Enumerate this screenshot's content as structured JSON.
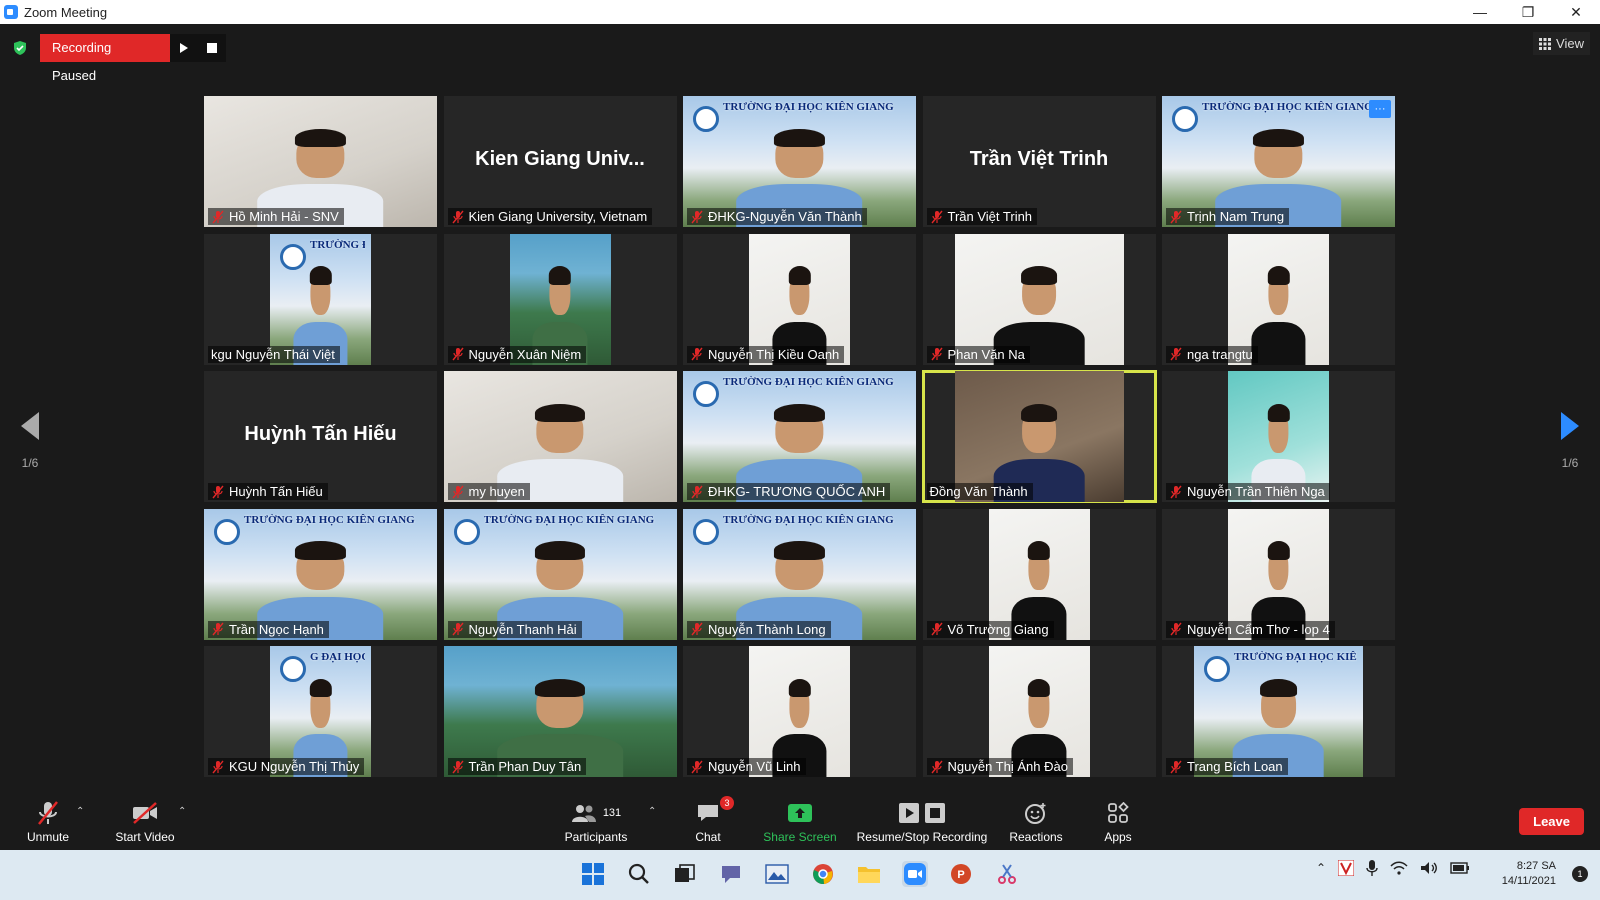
{
  "window": {
    "title": "Zoom Meeting",
    "controls": [
      "minimize",
      "restore",
      "close"
    ]
  },
  "recording": {
    "status": "Recording Paused",
    "resume_icon": "play-icon",
    "stop_icon": "stop-icon"
  },
  "view": {
    "label": "View"
  },
  "pagination": {
    "left_page": "1/6",
    "right_page": "1/6"
  },
  "tiles": [
    {
      "label": "Hồ Minh Hải - SNV",
      "type": "video",
      "bg": "room"
    },
    {
      "label": "Kien Giang University, Vietnam",
      "type": "name",
      "display_name": "Kien Giang Univ..."
    },
    {
      "label": "ĐHKG-Nguyễn Văn Thành",
      "type": "video",
      "bg": "kgu",
      "banner": "TRƯỜNG ĐẠI HỌC KIÊN GIANG"
    },
    {
      "label": "Trần Việt Trinh",
      "type": "name",
      "display_name": "Trần Việt Trinh"
    },
    {
      "label": "Trịnh Nam Trung",
      "type": "video",
      "bg": "kgu",
      "banner": "TRƯỜNG ĐẠI HỌC KIÊN GIANG",
      "menu": "···"
    },
    {
      "label": "kgu Nguyễn Thái Việt",
      "type": "video-narrow",
      "bg": "kgu",
      "banner": "TRƯỜNG ĐẠI HỌC KIÊ",
      "no_mic_icon": true
    },
    {
      "label": "Nguyễn Xuân Niệm",
      "type": "video-narrow",
      "bg": "green"
    },
    {
      "label": "Nguyễn Thị Kiều Oanh",
      "type": "video-narrow",
      "bg": "white"
    },
    {
      "label": "Phan Văn Na",
      "type": "video-mid",
      "bg": "white"
    },
    {
      "label": "nga trangtu",
      "type": "video-narrow",
      "bg": "white"
    },
    {
      "label": "Huỳnh Tấn Hiếu",
      "type": "name",
      "display_name": "Huỳnh Tấn Hiếu"
    },
    {
      "label": "my huyen",
      "type": "video",
      "bg": "room"
    },
    {
      "label": "ĐHKG- TRƯƠNG QUỐC ANH",
      "type": "video",
      "bg": "kgu",
      "banner": "TRƯỜNG ĐẠI HỌC KIÊN GIANG"
    },
    {
      "label": "Đồng Văn Thành",
      "type": "video-mid",
      "bg": "dark",
      "active": true,
      "no_mic_icon": true
    },
    {
      "label": "Nguyễn Trần Thiên Nga",
      "type": "video-narrow",
      "bg": "teal"
    },
    {
      "label": "Trần Ngọc Hạnh",
      "type": "video",
      "bg": "kgu",
      "banner": "TRƯỜNG ĐẠI HỌC KIÊN GIANG"
    },
    {
      "label": "Nguyễn Thanh Hải",
      "type": "video",
      "bg": "kgu",
      "banner": "TRƯỜNG ĐẠI HỌC KIÊN GIANG"
    },
    {
      "label": "Nguyễn Thành Long",
      "type": "video",
      "bg": "kgu",
      "banner": "TRƯỜNG ĐẠI HỌC KIÊN GIANG"
    },
    {
      "label": "Võ Trường Giang",
      "type": "video-narrow",
      "bg": "white"
    },
    {
      "label": "Nguyễn Cẩm Thơ - lop 4",
      "type": "video-narrow",
      "bg": "white"
    },
    {
      "label": "KGU Nguyễn Thị Thủy",
      "type": "video-narrow",
      "bg": "kgu",
      "banner": "G ĐẠI HỌC KIÊN"
    },
    {
      "label": "Trần Phan Duy Tân",
      "type": "video",
      "bg": "green"
    },
    {
      "label": "Nguyễn Vũ Linh",
      "type": "video-narrow",
      "bg": "white"
    },
    {
      "label": "Nguyễn Thị Ánh Đào",
      "type": "video-narrow",
      "bg": "white"
    },
    {
      "label": "Trang Bích Loan",
      "type": "video-mid",
      "bg": "kgu",
      "banner": "TRƯỜNG ĐẠI HỌC KIÊN GIANG"
    }
  ],
  "toolbar": {
    "unmute": "Unmute",
    "start_video": "Start Video",
    "participants": "Participants",
    "participants_count": "131",
    "chat": "Chat",
    "chat_badge": "3",
    "share_screen": "Share Screen",
    "recording": "Resume/Stop Recording",
    "reactions": "Reactions",
    "apps": "Apps",
    "leave": "Leave",
    "colors": {
      "share": "#2ec25a",
      "leave": "#e02828"
    }
  },
  "taskbar": {
    "time": "8:27 SA",
    "date": "14/11/2021",
    "notification_count": "1",
    "apps": [
      "windows-start-icon",
      "search-icon",
      "task-view-icon",
      "teams-chat-icon",
      "photos-icon",
      "chrome-icon",
      "file-explorer-icon",
      "zoom-icon",
      "powerpoint-icon",
      "snipping-tool-icon"
    ],
    "tray": [
      "chevron-up-icon",
      "antivirus-icon",
      "microphone-icon",
      "wifi-icon",
      "volume-icon",
      "battery-icon"
    ]
  }
}
